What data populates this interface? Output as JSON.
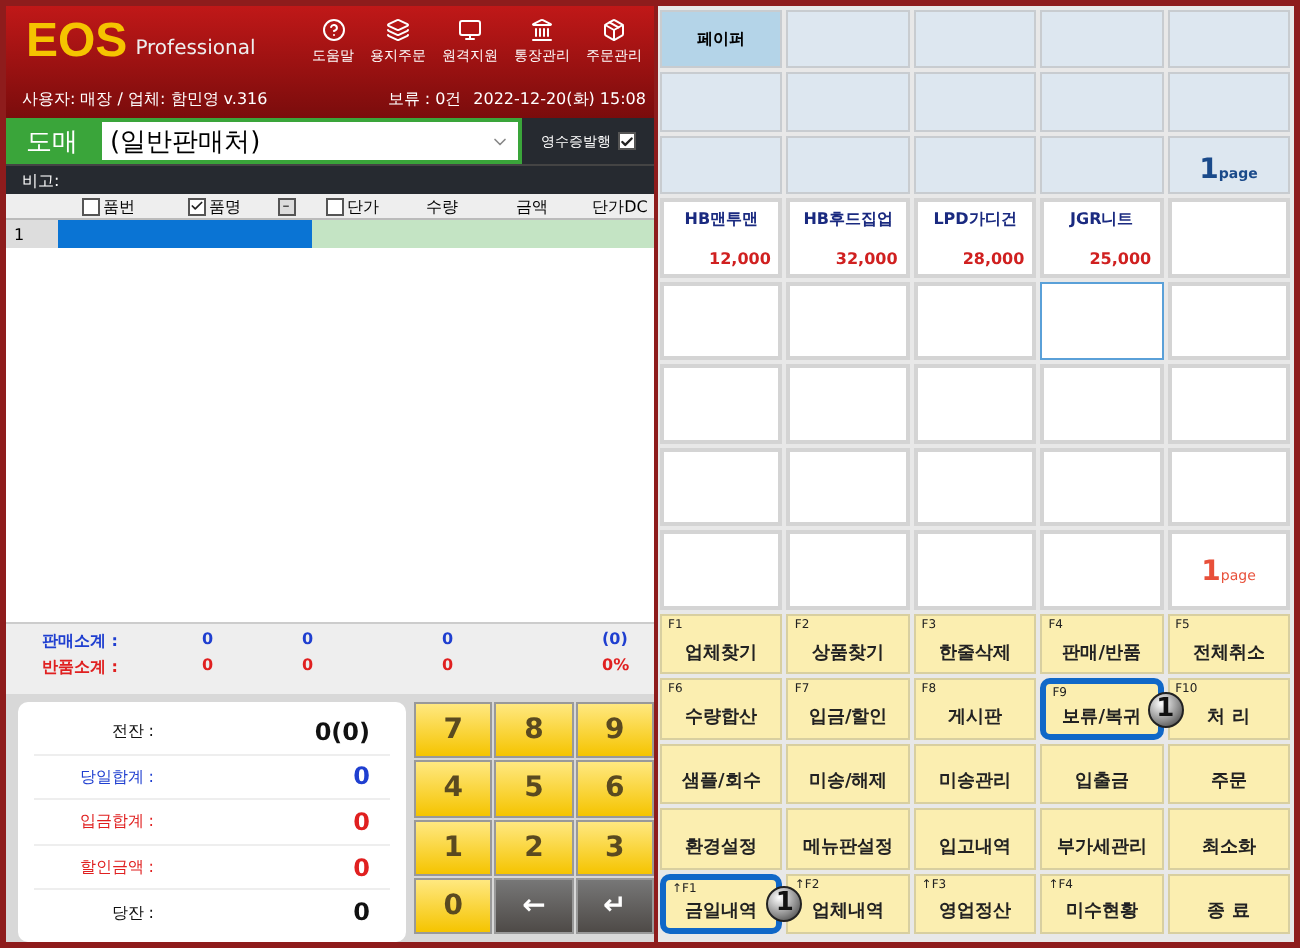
{
  "header": {
    "logo": "EOS",
    "edition": "Professional",
    "tools": [
      {
        "label": "도움말"
      },
      {
        "label": "용지주문"
      },
      {
        "label": "원격지원"
      },
      {
        "label": "통장관리"
      },
      {
        "label": "주문관리"
      }
    ]
  },
  "info": {
    "user": "사용자: 매장 / 업체: 함민영 v.316",
    "hold": "보류 :  0건",
    "datetime": "2022-12-20(화) 15:08"
  },
  "sale": {
    "mode": "도매",
    "customer": "(일반판매처)",
    "receipt": {
      "label": "영수증발행",
      "checked": true
    }
  },
  "remark": "비고:",
  "table": {
    "columns": [
      {
        "label": "품번",
        "kind": "check",
        "checked": false
      },
      {
        "label": "품명",
        "kind": "check",
        "checked": true
      },
      {
        "label": "–",
        "kind": "toggle"
      },
      {
        "label": "단가",
        "kind": "check",
        "checked": false
      },
      {
        "label": "수량",
        "kind": "text"
      },
      {
        "label": "금액",
        "kind": "text"
      },
      {
        "label": "단가DC",
        "kind": "text"
      }
    ],
    "rows": [
      {
        "number": "1",
        "selected": true
      }
    ]
  },
  "subtotals": [
    {
      "label": "판매소계 :",
      "color": "#1f3fd0",
      "values": [
        "0",
        "0",
        "0",
        "(0)"
      ]
    },
    {
      "label": "반품소계 :",
      "color": "#e02020",
      "values": [
        "0",
        "0",
        "0",
        "0%"
      ]
    }
  ],
  "totals": [
    {
      "label": "전잔 :",
      "value": "0(0)",
      "color": "#111111"
    },
    {
      "label": "당일합계 :",
      "value": "0",
      "color": "#1f3fd0"
    },
    {
      "label": "입금합계 :",
      "value": "0",
      "color": "#e02020"
    },
    {
      "label": "할인금액 :",
      "value": "0",
      "color": "#e02020"
    },
    {
      "label": "당잔 :",
      "value": "0",
      "color": "#111111"
    }
  ],
  "numpad": [
    {
      "key": "7",
      "kind": "digit"
    },
    {
      "key": "8",
      "kind": "digit"
    },
    {
      "key": "9",
      "kind": "digit"
    },
    {
      "key": "4",
      "kind": "digit"
    },
    {
      "key": "5",
      "kind": "digit"
    },
    {
      "key": "6",
      "kind": "digit"
    },
    {
      "key": "1",
      "kind": "digit"
    },
    {
      "key": "2",
      "kind": "digit"
    },
    {
      "key": "3",
      "kind": "digit"
    },
    {
      "key": "0",
      "kind": "digit"
    },
    {
      "key": "←",
      "kind": "action"
    },
    {
      "key": "↵",
      "kind": "action"
    }
  ],
  "categories": [
    {
      "kind": "item",
      "label": "페이퍼",
      "selected": true
    },
    {
      "kind": "empty",
      "selected": false
    },
    {
      "kind": "empty",
      "selected": false
    },
    {
      "kind": "empty",
      "selected": false
    },
    {
      "kind": "empty",
      "selected": false
    },
    {
      "kind": "empty",
      "selected": false
    },
    {
      "kind": "empty",
      "selected": false
    },
    {
      "kind": "empty",
      "selected": false
    },
    {
      "kind": "empty",
      "selected": false
    },
    {
      "kind": "empty",
      "selected": false
    },
    {
      "kind": "empty",
      "selected": false
    },
    {
      "kind": "empty",
      "selected": false
    },
    {
      "kind": "empty",
      "selected": false
    },
    {
      "kind": "empty",
      "selected": false
    },
    {
      "kind": "page",
      "number": "1",
      "unit": "page",
      "selected": false
    }
  ],
  "products": [
    {
      "kind": "item",
      "name": "HB맨투맨",
      "price": "12,000",
      "selected": false
    },
    {
      "kind": "item",
      "name": "HB후드집업",
      "price": "32,000",
      "selected": false
    },
    {
      "kind": "item",
      "name": "LPD가디건",
      "price": "28,000",
      "selected": false
    },
    {
      "kind": "item",
      "name": "JGR니트",
      "price": "25,000",
      "selected": false
    },
    {
      "kind": "empty",
      "selected": false
    },
    {
      "kind": "empty",
      "selected": false
    },
    {
      "kind": "empty",
      "selected": false
    },
    {
      "kind": "empty",
      "selected": false
    },
    {
      "kind": "empty",
      "selected": true
    },
    {
      "kind": "empty",
      "selected": false
    },
    {
      "kind": "empty",
      "selected": false
    },
    {
      "kind": "empty",
      "selected": false
    },
    {
      "kind": "empty",
      "selected": false
    },
    {
      "kind": "empty",
      "selected": false
    },
    {
      "kind": "empty",
      "selected": false
    },
    {
      "kind": "empty",
      "selected": false
    },
    {
      "kind": "empty",
      "selected": false
    },
    {
      "kind": "empty",
      "selected": false
    },
    {
      "kind": "empty",
      "selected": false
    },
    {
      "kind": "empty",
      "selected": false
    },
    {
      "kind": "empty",
      "selected": false
    },
    {
      "kind": "empty",
      "selected": false
    },
    {
      "kind": "empty",
      "selected": false
    },
    {
      "kind": "empty",
      "selected": false
    },
    {
      "kind": "page",
      "number": "1",
      "unit": "page",
      "selected": false
    }
  ],
  "functions": [
    {
      "key": "F1",
      "label": "업체찾기",
      "highlighted": false
    },
    {
      "key": "F2",
      "label": "상품찾기",
      "highlighted": false
    },
    {
      "key": "F3",
      "label": "한줄삭제",
      "highlighted": false
    },
    {
      "key": "F4",
      "label": "판매/반품",
      "highlighted": false
    },
    {
      "key": "F5",
      "label": "전체취소",
      "highlighted": false
    },
    {
      "key": "F6",
      "label": "수량합산",
      "highlighted": false
    },
    {
      "key": "F7",
      "label": "입금/할인",
      "highlighted": false
    },
    {
      "key": "F8",
      "label": "게시판",
      "highlighted": false
    },
    {
      "key": "F9",
      "label": "보류/복귀",
      "highlighted": true,
      "badge": "1"
    },
    {
      "key": "F10",
      "label": "처  리",
      "highlighted": false
    },
    {
      "label": "샘플/회수",
      "highlighted": false
    },
    {
      "label": "미송/해제",
      "highlighted": false
    },
    {
      "label": "미송관리",
      "highlighted": false
    },
    {
      "label": "입출금",
      "highlighted": false
    },
    {
      "label": "주문",
      "highlighted": false
    },
    {
      "label": "환경설정",
      "highlighted": false
    },
    {
      "label": "메뉴판설정",
      "highlighted": false
    },
    {
      "label": "입고내역",
      "highlighted": false
    },
    {
      "label": "부가세관리",
      "highlighted": false
    },
    {
      "label": "최소화",
      "highlighted": false
    },
    {
      "key": "↑F1",
      "label": "금일내역",
      "highlighted": true,
      "badge": "1"
    },
    {
      "key": "↑F2",
      "label": "업체내역",
      "highlighted": false
    },
    {
      "key": "↑F3",
      "label": "영업정산",
      "highlighted": false
    },
    {
      "key": "↑F4",
      "label": "미수현황",
      "highlighted": false
    },
    {
      "label": "종  료",
      "highlighted": false
    }
  ]
}
